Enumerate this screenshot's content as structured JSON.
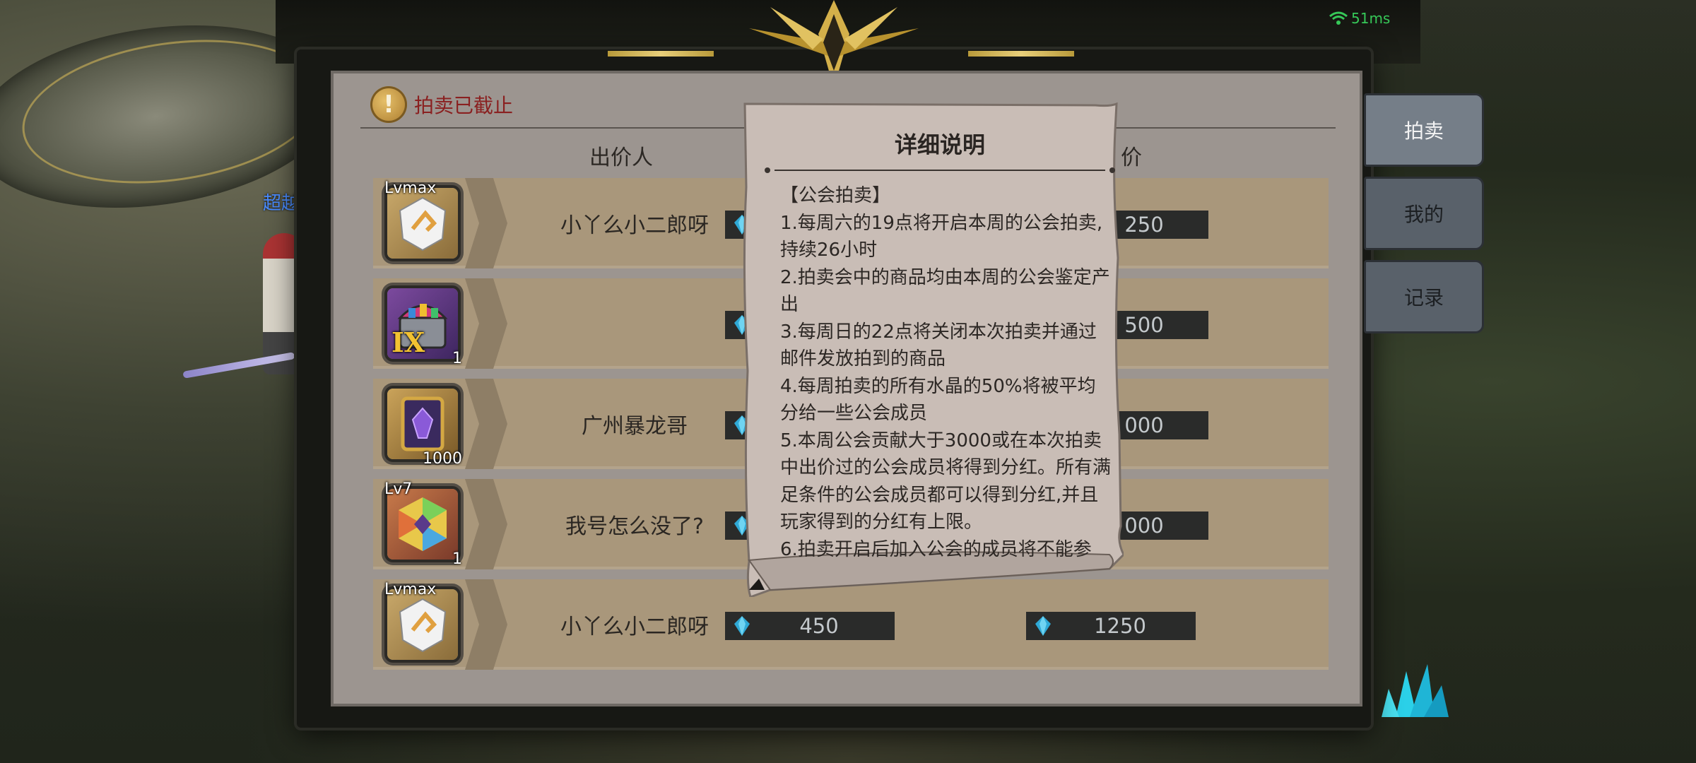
{
  "network": {
    "ping": "51ms"
  },
  "background": {
    "player_name": "超越"
  },
  "auction": {
    "status_icon": "exclamation-icon",
    "status_text": "拍卖已截止",
    "columns": {
      "bidder": "出价人",
      "price_suffix": "价"
    },
    "rows": [
      {
        "item_icon": "white-stone-icon",
        "level": "Lvmax",
        "count": "",
        "bidder": "小丫么小二郎呀",
        "start_price": "",
        "buyout_price": "250"
      },
      {
        "item_icon": "treasure-chest-icon",
        "level": "",
        "count": "1",
        "bidder": "",
        "start_price": "",
        "buyout_price": "500"
      },
      {
        "item_icon": "purple-book-icon",
        "level": "",
        "count": "1000",
        "bidder": "广州暴龙哥",
        "start_price": "",
        "buyout_price": "000"
      },
      {
        "item_icon": "rainbow-gem-icon",
        "level": "Lv7",
        "count": "1",
        "bidder": "我号怎么没了?",
        "start_price": "",
        "buyout_price": "000"
      },
      {
        "item_icon": "white-stone-icon",
        "level": "Lvmax",
        "count": "",
        "bidder": "小丫么小二郎呀",
        "start_price": "450",
        "buyout_price": "1250"
      }
    ],
    "chest_roman": "IX"
  },
  "tabs": [
    {
      "label": "拍卖",
      "active": true
    },
    {
      "label": "我的",
      "active": false
    },
    {
      "label": "记录",
      "active": false
    }
  ],
  "details": {
    "title": "详细说明",
    "lines": [
      "【公会拍卖】",
      "1.每周六的19点将开启本周的公会拍卖,持续26小时",
      "2.拍卖会中的商品均由本周的公会鉴定产出",
      "3.每周日的22点将关闭本次拍卖并通过邮件发放拍到的商品",
      "4.每周拍卖的所有水晶的50%将被平均分给一些公会成员",
      "5.本周公会贡献大于3000或在本次拍卖中出价过的公会成员将得到分红。所有满足条件的公会成员都可以得到分红,并且玩家得到的分红有上限。",
      "6.拍卖开启后加入公会的成员将不能参"
    ]
  },
  "colors": {
    "panel": "#9c9590",
    "row": "#a9977b",
    "status_red": "#8a2020",
    "gem_blue": "#2fa9d6",
    "tab_active": "#757e88",
    "tab_inactive": "#59616a"
  }
}
